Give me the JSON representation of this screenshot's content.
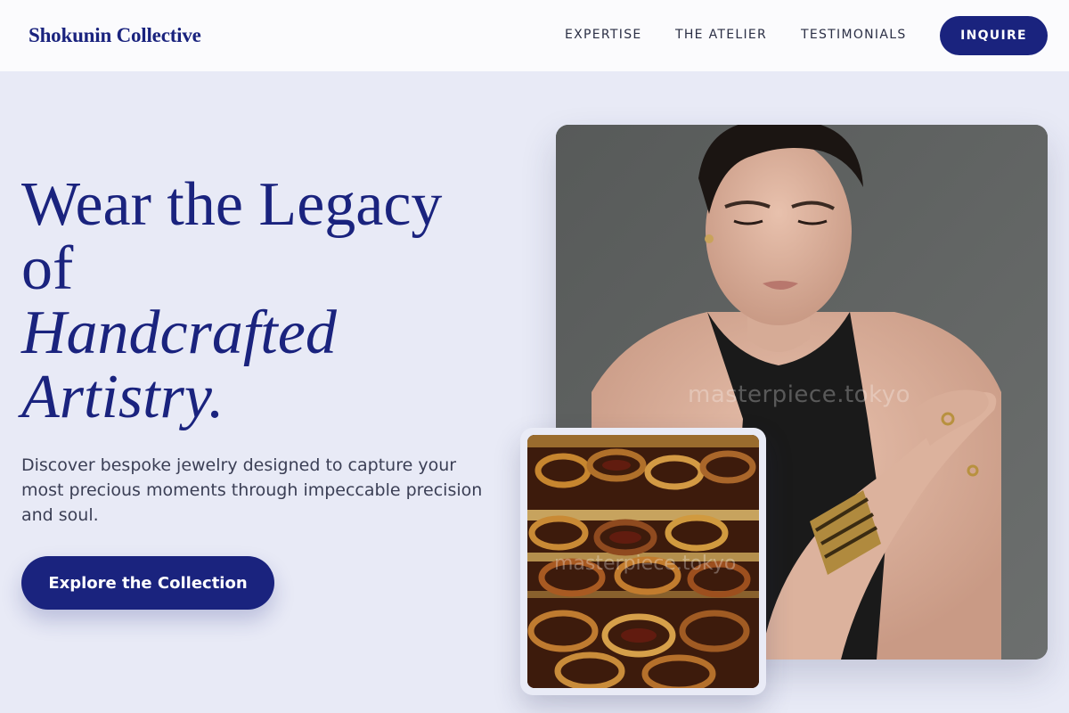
{
  "header": {
    "brand": "Shokunin Collective",
    "nav": [
      "EXPERTISE",
      "THE ATELIER",
      "TESTIMONIALS"
    ],
    "inquire_label": "INQUIRE"
  },
  "hero": {
    "headline_line1": "Wear the Legacy",
    "headline_line2": "of",
    "headline_italic_1": "Handcrafted",
    "headline_italic_2": "Artistry.",
    "subtext": "Discover bespoke jewelry designed to capture your most precious moments through impeccable precision and soul.",
    "cta_label": "Explore the Collection"
  },
  "images": {
    "main_watermark": "masterpiece.tokyo",
    "secondary_watermark": "masterpiece.tokyo"
  },
  "colors": {
    "accent": "#1a237e",
    "background": "#e8eaf6",
    "header_bg": "#fbfbfd"
  }
}
